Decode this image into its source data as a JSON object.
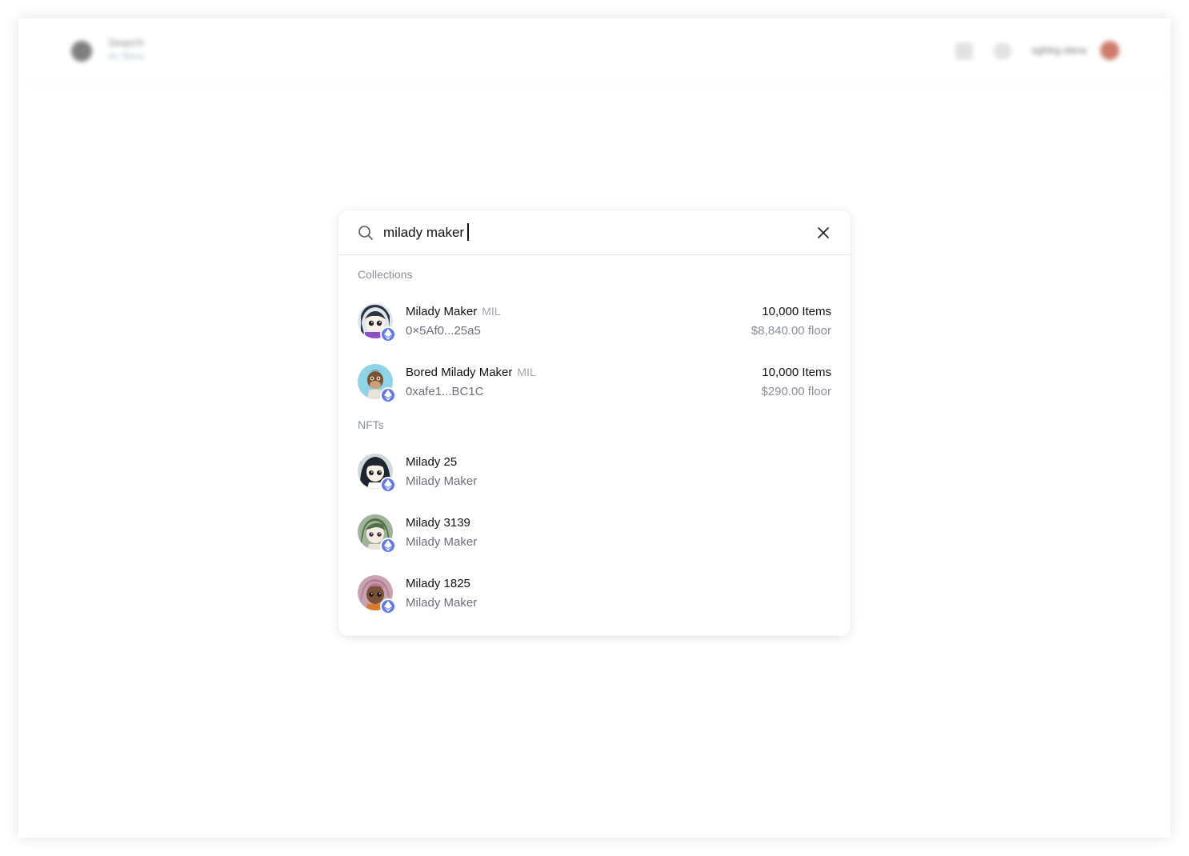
{
  "topbar": {
    "search_title": "Search",
    "search_sub": "on Stera",
    "username": "sghtrg.stera"
  },
  "search": {
    "query": "milady maker"
  },
  "sections": {
    "collections_label": "Collections",
    "nfts_label": "NFTs"
  },
  "collections": [
    {
      "name": "Milady Maker",
      "ticker": "MIL",
      "address": "0×5Af0...25a5",
      "items": "10,000 Items",
      "floor": "$8,840.00 floor"
    },
    {
      "name": "Bored Milady Maker",
      "ticker": "MIL",
      "address": "0xafe1...BC1C",
      "items": "10,000 Items",
      "floor": "$290.00 floor"
    }
  ],
  "nfts": [
    {
      "name": "Milady 25",
      "collection": "Milady Maker"
    },
    {
      "name": "Milady 3139",
      "collection": "Milady Maker"
    },
    {
      "name": "Milady 1825",
      "collection": "Milady Maker"
    }
  ],
  "colors": {
    "eth_badge": "#6278e8",
    "muted_text": "#8a8f98"
  }
}
